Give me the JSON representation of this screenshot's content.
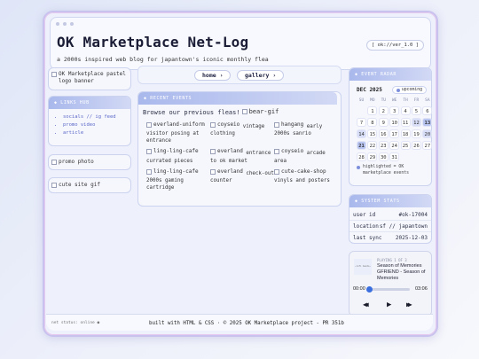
{
  "header": {
    "title": "OK Marketplace Net-Log",
    "tagline": "a 2000s inspired web blog for japantown's iconic monthly flea",
    "version": "[ ok://ver_1.0 ]"
  },
  "left": {
    "logo_alt": "OK Marketplace pastel logo banner",
    "links_title": "LINKS HUB",
    "links": [
      "socials // ig feed",
      "promo video",
      "article"
    ],
    "promo_photo_alt": "promo photo",
    "gif_alt": "cute site gif"
  },
  "nav": {
    "home": "home",
    "gallery": "gallery"
  },
  "events": {
    "title": "RECENT EVENTS",
    "lead": "Browse our previous fleas!",
    "lead_img_alt": "bear-gif",
    "items": [
      {
        "alt": "everland-uniform",
        "caption": "visitor posing at entrance"
      },
      {
        "alt": "coyseio",
        "caption": "vintage clothing"
      },
      {
        "alt": "hangang",
        "caption": "early 2000s sanrio"
      },
      {
        "alt": "ling-ling-cafe",
        "caption": "currated pieces"
      },
      {
        "alt": "everland",
        "caption": "entrance to ok market"
      },
      {
        "alt": "coyseio",
        "caption": "arcade area"
      },
      {
        "alt": "ling-ling-cafe",
        "caption": "2000s gaming cartridge"
      },
      {
        "alt": "everland",
        "caption": "check-out counter"
      },
      {
        "alt": "cute-cake-shop",
        "caption": "vinyls and posters"
      }
    ]
  },
  "calendar": {
    "title": "EVENT RADAR",
    "month": "DEC 2025",
    "badge": "upcoming",
    "weekdays": [
      "SU",
      "MO",
      "TU",
      "WE",
      "TH",
      "FR",
      "SA"
    ],
    "days": [
      "",
      "1",
      "2",
      "3",
      "4",
      "5",
      "6",
      "7",
      "8",
      "9",
      "10",
      "11",
      "12",
      "13",
      "14",
      "15",
      "16",
      "17",
      "18",
      "19",
      "20",
      "21",
      "22",
      "23",
      "24",
      "25",
      "26",
      "27",
      "28",
      "29",
      "30",
      "31"
    ],
    "note": "highlighted = OK marketplace events"
  },
  "system": {
    "title": "SYSTEM STATS",
    "rows": [
      {
        "label": "user id",
        "value": "#ok-17004"
      },
      {
        "label": "location",
        "value": "sf // japantown"
      },
      {
        "label": "last sync",
        "value": "2025-12-03"
      }
    ]
  },
  "player": {
    "art_text": "~lofi beats~",
    "count": "PLAYING 1 OF 3",
    "track": "Season of Memories GFRIEND - Season of Memories",
    "time_start": "00:00",
    "time_end": "03:06",
    "progress": 0.0,
    "prev": "◀◀",
    "play": "▶",
    "next": "▶▶"
  },
  "footer": {
    "net_status": "net status: online ●",
    "text": "built with HTML & CSS · © 2025 OK Marketplace project - PR 351b"
  }
}
